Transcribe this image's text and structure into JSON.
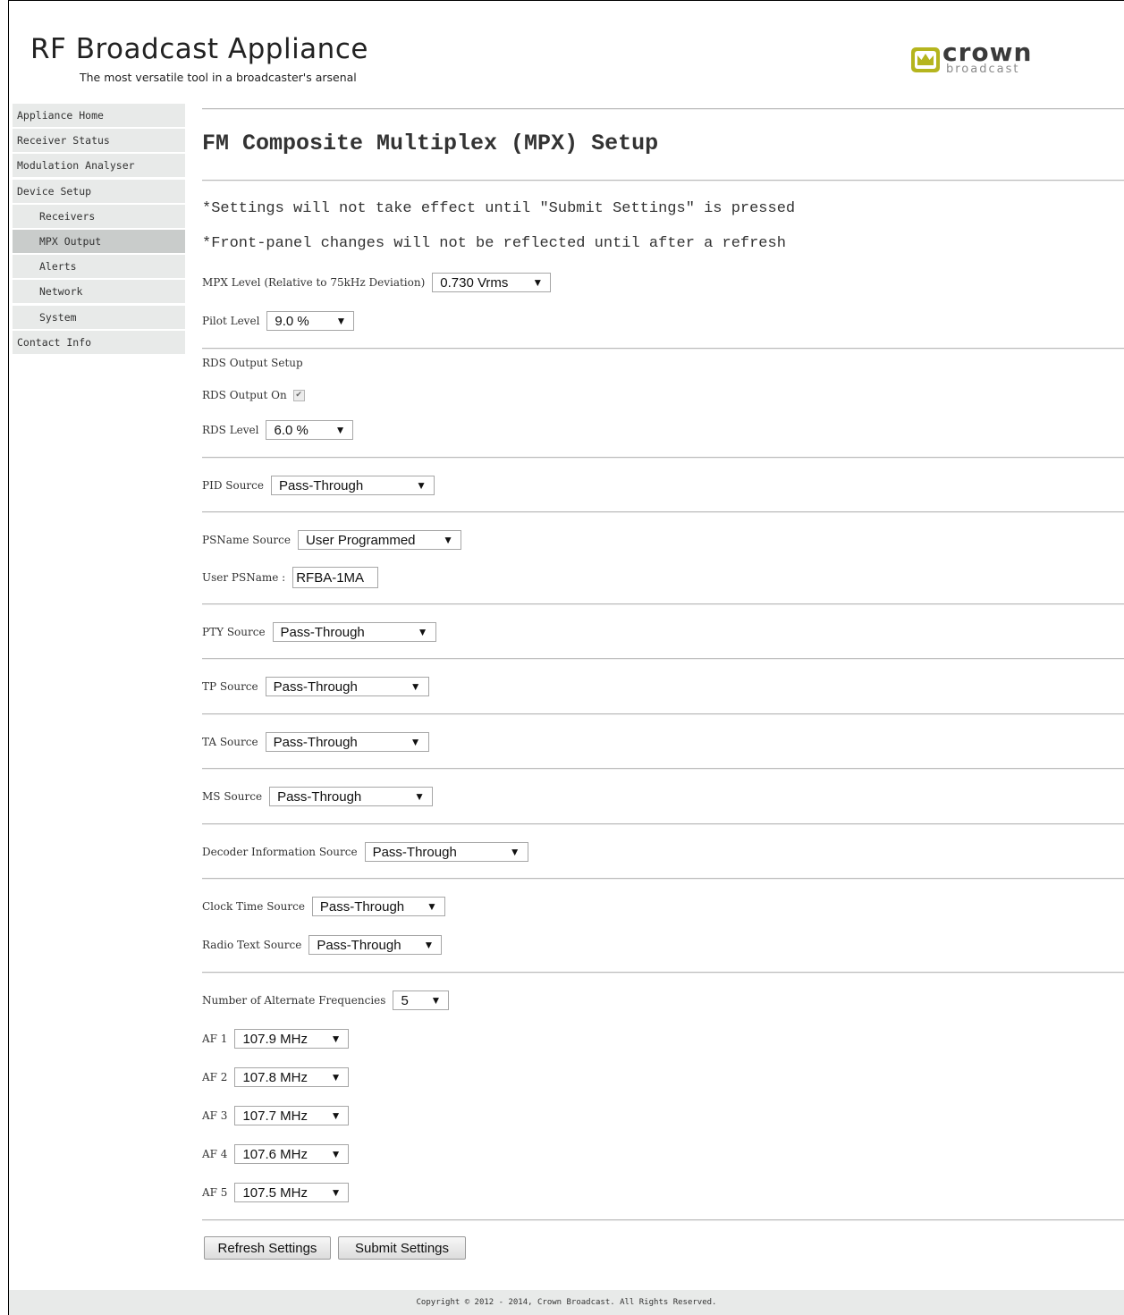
{
  "header": {
    "title": "RF Broadcast Appliance",
    "tagline": "The most versatile tool in a broadcaster's arsenal",
    "logo_word": "crown",
    "logo_sub": "broadcast",
    "logo_color": "#b5b51e"
  },
  "sidebar": {
    "items": [
      {
        "label": "Appliance Home"
      },
      {
        "label": "Receiver Status"
      },
      {
        "label": "Modulation Analyser"
      },
      {
        "label": "Device Setup"
      },
      {
        "label": "Receivers"
      },
      {
        "label": "MPX Output"
      },
      {
        "label": "Alerts"
      },
      {
        "label": "Network"
      },
      {
        "label": "System"
      },
      {
        "label": "Contact Info"
      }
    ],
    "active": "MPX Output"
  },
  "main": {
    "title": "FM Composite Multiplex (MPX) Setup",
    "notice1": "*Settings will not take effect until \"Submit Settings\" is pressed",
    "notice2": "*Front-panel changes will not be reflected until after a refresh",
    "mpx_level": {
      "label": "MPX Level (Relative to 75kHz Deviation)",
      "value": "0.730 Vrms"
    },
    "pilot_level": {
      "label": "Pilot Level",
      "value": "9.0 %"
    },
    "rds_heading": "RDS Output Setup",
    "rds_output_on": {
      "label": "RDS Output On",
      "checked": true
    },
    "rds_level": {
      "label": "RDS Level",
      "value": "6.0 %"
    },
    "pid_source": {
      "label": "PID Source",
      "value": "Pass-Through"
    },
    "psname_source": {
      "label": "PSName Source",
      "value": "User Programmed"
    },
    "user_psname": {
      "label": "User PSName :",
      "value": "RFBA-1MA"
    },
    "pty_source": {
      "label": "PTY Source",
      "value": "Pass-Through"
    },
    "tp_source": {
      "label": "TP Source",
      "value": "Pass-Through"
    },
    "ta_source": {
      "label": "TA Source",
      "value": "Pass-Through"
    },
    "ms_source": {
      "label": "MS Source",
      "value": "Pass-Through"
    },
    "decoder_source": {
      "label": "Decoder Information Source",
      "value": "Pass-Through"
    },
    "clock_source": {
      "label": "Clock Time Source",
      "value": "Pass-Through"
    },
    "radiotext_source": {
      "label": "Radio Text Source",
      "value": "Pass-Through"
    },
    "num_af": {
      "label": "Number of Alternate Frequencies",
      "value": "5"
    },
    "af": [
      {
        "label": "AF 1",
        "value": "107.9 MHz"
      },
      {
        "label": "AF 2",
        "value": "107.8 MHz"
      },
      {
        "label": "AF 3",
        "value": "107.7 MHz"
      },
      {
        "label": "AF 4",
        "value": "107.6 MHz"
      },
      {
        "label": "AF 5",
        "value": "107.5 MHz"
      }
    ],
    "refresh_label": "Refresh Settings",
    "submit_label": "Submit Settings"
  },
  "footer": {
    "text": "Copyright © 2012 - 2014, Crown Broadcast. All Rights Reserved."
  }
}
